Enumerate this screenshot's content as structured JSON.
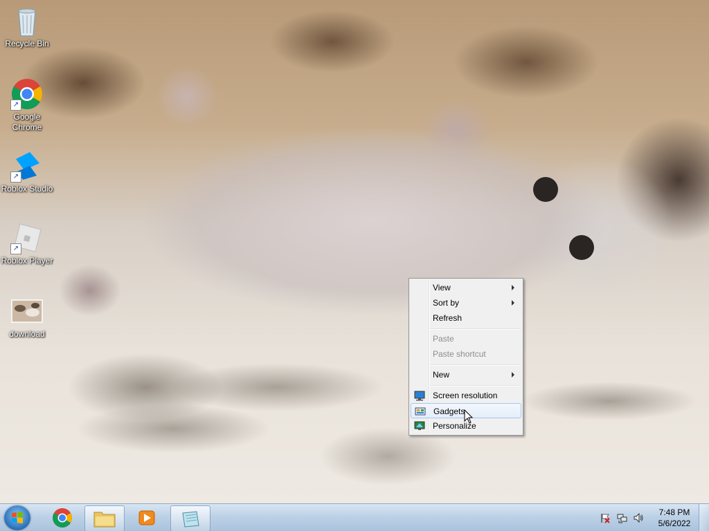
{
  "desktop": {
    "icons": [
      {
        "label": "Recycle Bin",
        "icon": "recycle-bin-icon"
      },
      {
        "label": "Google Chrome",
        "icon": "chrome-icon"
      },
      {
        "label": "Roblox Studio",
        "icon": "roblox-studio-icon"
      },
      {
        "label": "Roblox Player",
        "icon": "roblox-player-icon"
      },
      {
        "label": "download",
        "icon": "image-file-icon"
      }
    ],
    "label_lines": {
      "chrome_line1": "Google",
      "chrome_line2": "Chrome"
    }
  },
  "context_menu": {
    "items": [
      {
        "label": "View",
        "has_submenu": true,
        "enabled": true
      },
      {
        "label": "Sort by",
        "has_submenu": true,
        "enabled": true
      },
      {
        "label": "Refresh",
        "has_submenu": false,
        "enabled": true
      },
      {
        "label": "Paste",
        "has_submenu": false,
        "enabled": false
      },
      {
        "label": "Paste shortcut",
        "has_submenu": false,
        "enabled": false
      },
      {
        "label": "New",
        "has_submenu": true,
        "enabled": true
      },
      {
        "label": "Screen resolution",
        "has_submenu": false,
        "enabled": true,
        "icon": "screen-resolution-icon"
      },
      {
        "label": "Gadgets",
        "has_submenu": false,
        "enabled": true,
        "icon": "gadgets-icon",
        "highlighted": true
      },
      {
        "label": "Personalize",
        "has_submenu": false,
        "enabled": true,
        "icon": "personalize-icon"
      }
    ]
  },
  "taskbar": {
    "start_icon": "windows-start-orb-icon",
    "pinned": [
      {
        "name": "Google Chrome",
        "icon": "chrome-icon"
      },
      {
        "name": "Windows Explorer",
        "icon": "folder-icon"
      },
      {
        "name": "Windows Media Player",
        "icon": "media-player-icon"
      },
      {
        "name": "Notepad",
        "icon": "notepad-icon"
      }
    ],
    "tray_icons": [
      "action-center-flag-icon",
      "network-icon",
      "volume-icon"
    ],
    "clock": {
      "time": "7:48 PM",
      "date": "5/6/2022"
    }
  },
  "colors": {
    "taskbar_top": "#d9e6f3",
    "menu_bg": "#f0f0f0",
    "menu_highlight": "#e6eefa"
  }
}
